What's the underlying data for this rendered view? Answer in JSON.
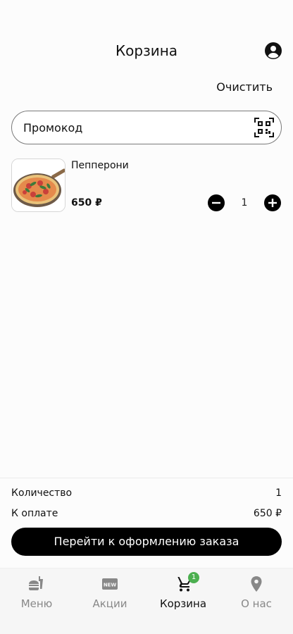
{
  "header": {
    "title": "Корзина",
    "profile_icon": "account-circle-icon"
  },
  "actions": {
    "clear_label": "Очистить"
  },
  "promo": {
    "placeholder": "Промокод",
    "value": "",
    "scan_icon": "qr-code-icon"
  },
  "cart": {
    "items": [
      {
        "name": "Пепперони",
        "price": "650 ₽",
        "quantity": "1",
        "image_icon": "pizza-image"
      }
    ]
  },
  "summary": {
    "count_label": "Количество",
    "count_value": "1",
    "total_label": "К оплате",
    "total_value": "650 ₽",
    "checkout_label": "Перейти к оформлению заказа"
  },
  "tabs": [
    {
      "label": "Меню",
      "icon": "fastfood-icon",
      "active": false
    },
    {
      "label": "Акции",
      "icon": "new-icon",
      "active": false
    },
    {
      "label": "Корзина",
      "icon": "cart-icon",
      "active": true,
      "badge": "1"
    },
    {
      "label": "О нас",
      "icon": "location-pin-icon",
      "active": false
    }
  ],
  "colors": {
    "accent": "#000000",
    "badge": "#4caf50",
    "inactive_tab": "#888888"
  }
}
